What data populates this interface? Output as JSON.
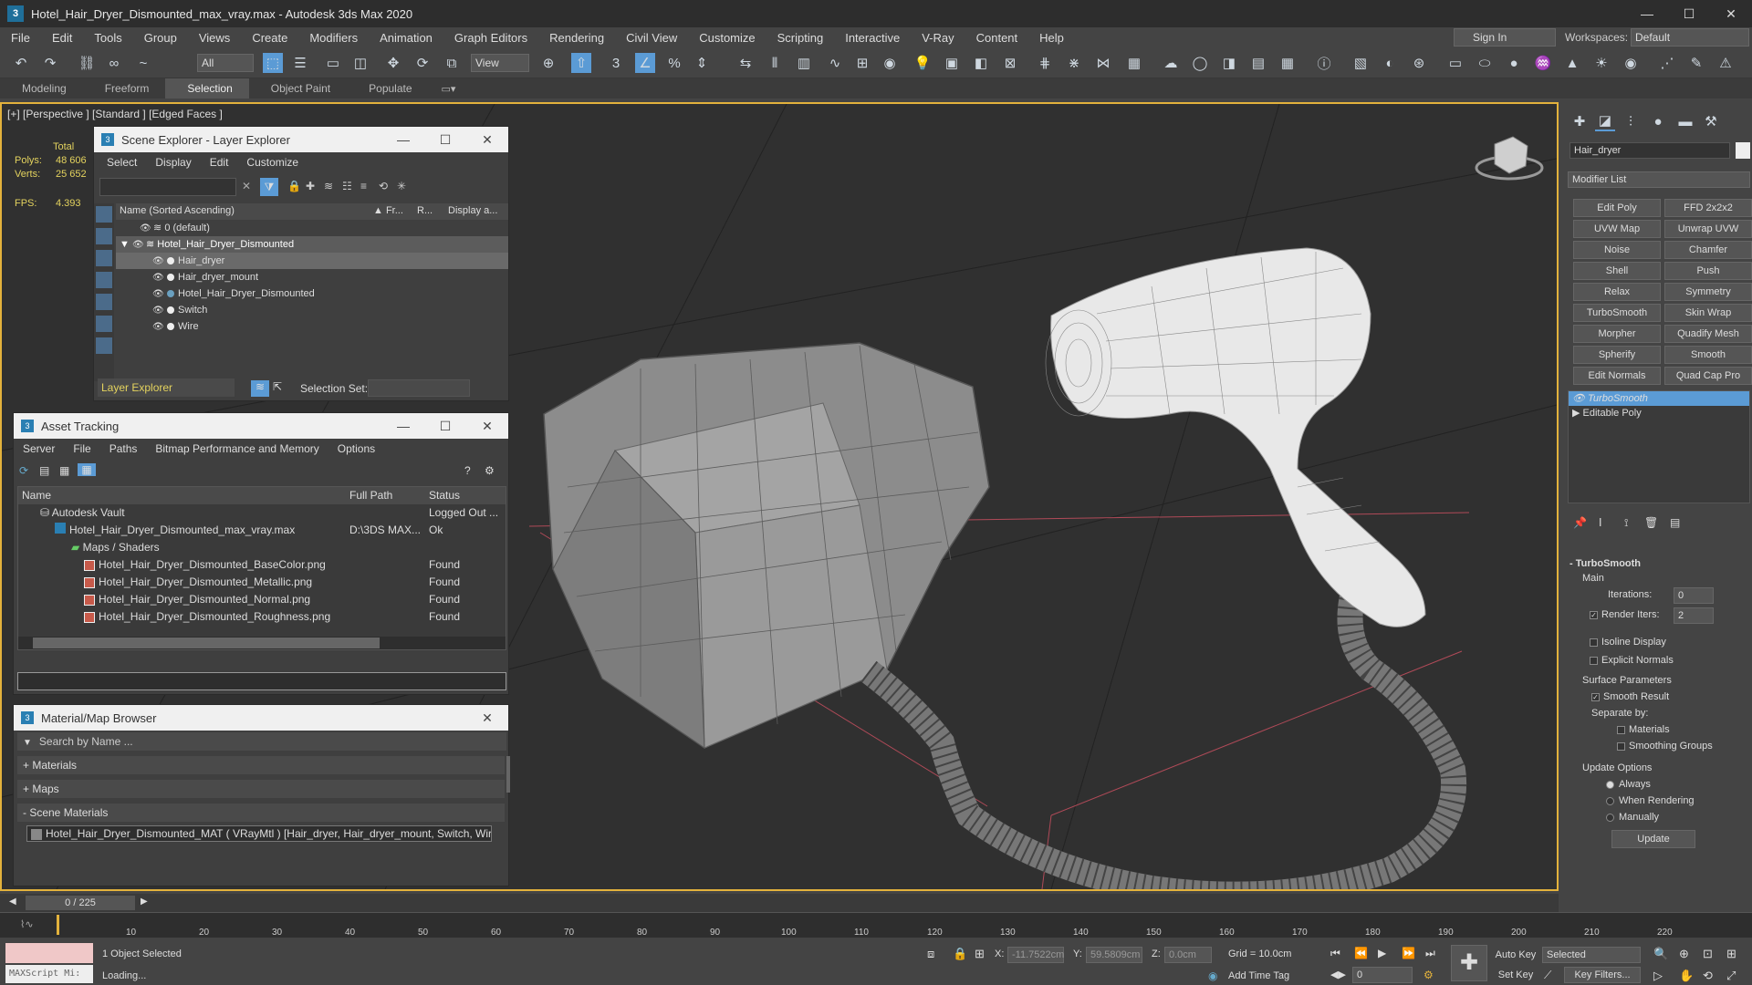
{
  "titlebar": {
    "title": "Hotel_Hair_Dryer_Dismounted_max_vray.max - Autodesk 3ds Max 2020",
    "app_icon": "3",
    "minimize": "—",
    "maximize": "☐",
    "close": "✕"
  },
  "menu": [
    "File",
    "Edit",
    "Tools",
    "Group",
    "Views",
    "Create",
    "Modifiers",
    "Animation",
    "Graph Editors",
    "Rendering",
    "Civil View",
    "Customize",
    "Scripting",
    "Interactive",
    "V-Ray",
    "Content",
    "Help"
  ],
  "account": {
    "sign_in": "Sign In",
    "workspaces_label": "Workspaces:",
    "workspace": "Default"
  },
  "toolbar": {
    "selection_filter": "All",
    "ref_coord": "View"
  },
  "ribbon": {
    "tabs": [
      "Modeling",
      "Freeform",
      "Selection",
      "Object Paint",
      "Populate"
    ],
    "active": "Selection"
  },
  "viewport": {
    "label": "[+] [Perspective ] [Standard ] [Edged Faces ]",
    "stats": {
      "total": "Total",
      "polys_label": "Polys:",
      "polys": "48 606",
      "verts_label": "Verts:",
      "verts": "25 652",
      "fps_label": "FPS:",
      "fps": "4.393"
    }
  },
  "scene_explorer": {
    "title": "Scene Explorer - Layer Explorer",
    "menu": [
      "Select",
      "Display",
      "Edit",
      "Customize"
    ],
    "columns": [
      "Name (Sorted Ascending)",
      "▲ Fr...",
      "R...",
      "Display a..."
    ],
    "rows": [
      {
        "name": "0 (default)",
        "indent": 1
      },
      {
        "name": "Hotel_Hair_Dryer_Dismounted",
        "indent": 0
      },
      {
        "name": "Hair_dryer",
        "indent": 2
      },
      {
        "name": "Hair_dryer_mount",
        "indent": 2
      },
      {
        "name": "Hotel_Hair_Dryer_Dismounted",
        "indent": 2
      },
      {
        "name": "Switch",
        "indent": 2
      },
      {
        "name": "Wire",
        "indent": 2
      }
    ],
    "footer_layer": "Layer Explorer",
    "selection_set_label": "Selection Set:"
  },
  "asset_tracking": {
    "title": "Asset Tracking",
    "menu": [
      "Server",
      "File",
      "Paths",
      "Bitmap Performance and Memory",
      "Options"
    ],
    "columns": [
      "Name",
      "Full Path",
      "Status"
    ],
    "rows": [
      {
        "name": "Autodesk Vault",
        "path": "",
        "status": "Logged Out ...",
        "indent": 1
      },
      {
        "name": "Hotel_Hair_Dryer_Dismounted_max_vray.max",
        "path": "D:\\3DS MAX...",
        "status": "Ok",
        "indent": 2
      },
      {
        "name": "Maps / Shaders",
        "path": "",
        "status": "",
        "indent": 3
      },
      {
        "name": "Hotel_Hair_Dryer_Dismounted_BaseColor.png",
        "path": "",
        "status": "Found",
        "indent": 4
      },
      {
        "name": "Hotel_Hair_Dryer_Dismounted_Metallic.png",
        "path": "",
        "status": "Found",
        "indent": 4
      },
      {
        "name": "Hotel_Hair_Dryer_Dismounted_Normal.png",
        "path": "",
        "status": "Found",
        "indent": 4
      },
      {
        "name": "Hotel_Hair_Dryer_Dismounted_Roughness.png",
        "path": "",
        "status": "Found",
        "indent": 4
      }
    ]
  },
  "material_browser": {
    "title": "Material/Map Browser",
    "search_placeholder": "Search by Name ...",
    "groups": [
      "+ Materials",
      "+ Maps",
      "- Scene Materials"
    ],
    "scene_material": "Hotel_Hair_Dryer_Dismounted_MAT ( VRayMtl ) [Hair_dryer, Hair_dryer_mount, Switch, Wire]"
  },
  "command_panel": {
    "object_name": "Hair_dryer",
    "modifier_list": "Modifier List",
    "modifier_buttons": [
      "Edit Poly",
      "FFD 2x2x2",
      "UVW Map",
      "Unwrap UVW",
      "Noise",
      "Chamfer",
      "Shell",
      "Push",
      "Relax",
      "Symmetry",
      "TurboSmooth",
      "Skin Wrap",
      "Morpher",
      "Quadify Mesh",
      "Spherify",
      "Smooth",
      "Edit Normals",
      "Quad Cap Pro"
    ],
    "stack": [
      "TurboSmooth",
      "Editable Poly"
    ],
    "turbosmooth": {
      "rollout": "TurboSmooth",
      "main": "Main",
      "iterations_label": "Iterations:",
      "iterations": "0",
      "render_iters_label": "Render Iters:",
      "render_iters": "2",
      "isoline": "Isoline Display",
      "explicit_normals": "Explicit Normals",
      "surface_params": "Surface Parameters",
      "smooth_result": "Smooth Result",
      "separate_by": "Separate by:",
      "materials": "Materials",
      "smoothing_groups": "Smoothing Groups",
      "update_options": "Update Options",
      "always": "Always",
      "when_rendering": "When Rendering",
      "manually": "Manually",
      "update_btn": "Update"
    }
  },
  "timeline": {
    "frame": "0 / 225",
    "ticks": [
      "10",
      "20",
      "30",
      "40",
      "50",
      "60",
      "70",
      "80",
      "90",
      "100",
      "110",
      "120",
      "130",
      "140",
      "150",
      "160",
      "170",
      "180",
      "190",
      "200",
      "210",
      "220"
    ]
  },
  "status": {
    "maxscript": "MAXScript Mi:",
    "selected": "1 Object Selected",
    "loading": "Loading...",
    "x_label": "X:",
    "x": "-11.7522cm",
    "y_label": "Y:",
    "y": "59.5809cm",
    "z_label": "Z:",
    "z": "0.0cm",
    "grid": "Grid = 10.0cm",
    "add_time_tag": "Add Time Tag",
    "frame_field": "0",
    "auto_key": "Auto Key",
    "set_key": "Set Key",
    "selected_dropdown": "Selected",
    "key_filters": "Key Filters..."
  },
  "colors": {
    "accent": "#e3b23c",
    "selection_blue": "#5b9bd5",
    "viewport_bg": "#303030"
  }
}
